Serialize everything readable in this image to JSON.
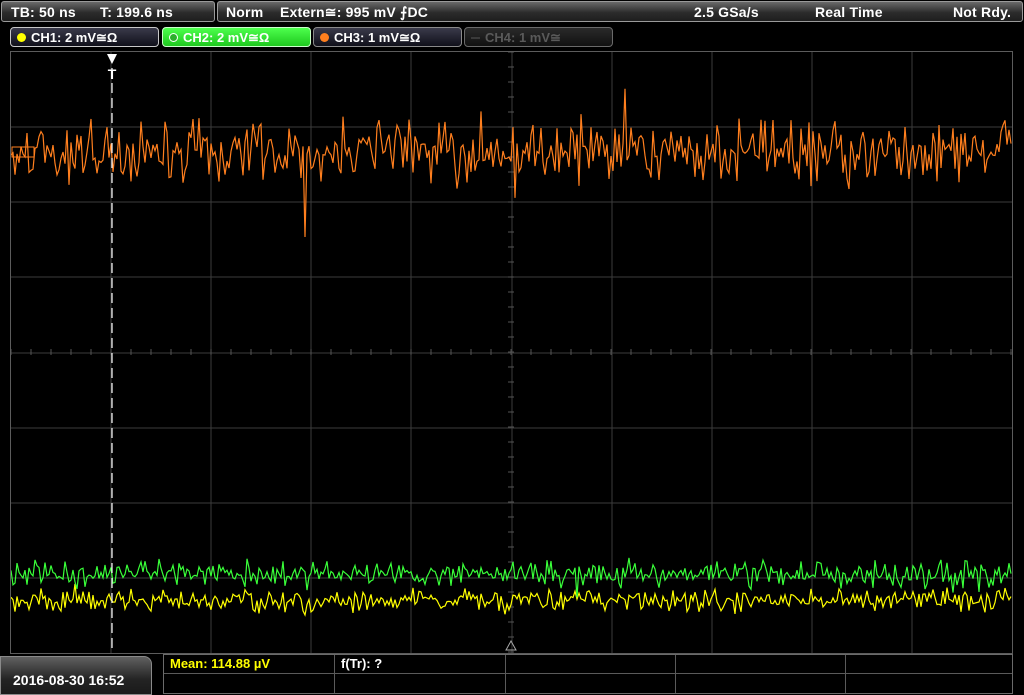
{
  "status_bar": {
    "timebase": "TB: 50 ns",
    "trigger_time": "T: 199.6 ns",
    "mode": "Norm",
    "trigger_source": "Extern≅: 995 mV ⨍DC",
    "sample_rate": "2.5 GSa/s",
    "acquisition": "Real Time",
    "state": "Not Rdy."
  },
  "channels": [
    {
      "label": "CH1: 2 mV≅Ω",
      "color": "#ffff00",
      "active": false
    },
    {
      "label": "CH2: 2 mV≅Ω",
      "color": "#39ff39",
      "active": true
    },
    {
      "label": "CH3: 1 mV≅Ω",
      "color": "#ff7f1e",
      "active": false
    },
    {
      "label": "CH4: 1 mV≅",
      "color": "#5a5a5a",
      "active": false
    }
  ],
  "trigger_marker": "T",
  "measurements": {
    "mean": "Mean: 114.88 µV",
    "ftr": "f(Tr): ?"
  },
  "datetime": "2016-08-30 16:52",
  "colors": {
    "grid": "#3c3c3c",
    "trigger_line": "#ffffff",
    "measure_text": "#ffff00",
    "ch1": "#ffff00",
    "ch2": "#39ff39",
    "ch3": "#ff7f1e"
  }
}
